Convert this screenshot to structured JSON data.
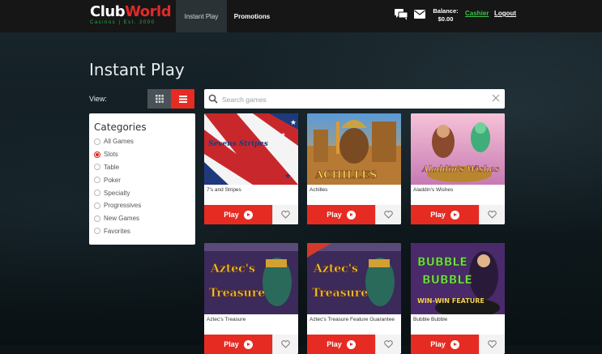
{
  "header": {
    "logo_main_part1": "Club",
    "logo_main_part2": "World",
    "logo_sub": "Casinos | Est. 2000",
    "nav": [
      {
        "label": "Instant Play"
      },
      {
        "label": "Promotions"
      }
    ],
    "balance_label": "Balance:",
    "balance_value": "$0.00",
    "cashier_label": "Cashier",
    "logout_label": "Logout"
  },
  "page": {
    "title": "Instant Play",
    "view_label": "View:"
  },
  "search": {
    "placeholder": "Search games"
  },
  "categories": {
    "title": "Categories",
    "items": [
      {
        "label": "All Games",
        "selected": false
      },
      {
        "label": "Slots",
        "selected": true
      },
      {
        "label": "Table",
        "selected": false
      },
      {
        "label": "Poker",
        "selected": false
      },
      {
        "label": "Specialty",
        "selected": false
      },
      {
        "label": "Progressives",
        "selected": false
      },
      {
        "label": "New Games",
        "selected": false
      },
      {
        "label": "Favorites",
        "selected": false
      }
    ]
  },
  "games": [
    {
      "name": "7's and Stripes",
      "thumb_title": "Sevens Stripes",
      "play_label": "Play"
    },
    {
      "name": "Achilles",
      "thumb_title": "ACHILLES",
      "play_label": "Play"
    },
    {
      "name": "Aladdin's Wishes",
      "thumb_title": "Aladdin's Wishes",
      "play_label": "Play"
    },
    {
      "name": "Aztec's Treasure",
      "thumb_title": "Aztec's Treasure",
      "play_label": "Play"
    },
    {
      "name": "Aztec's Treasure Feature Guarantee",
      "thumb_title": "Aztec's Treasure",
      "play_label": "Play"
    },
    {
      "name": "Bubble Bubble",
      "thumb_title": "Bubble Bubble",
      "thumb_sub": "WIN-WIN FEATURE",
      "play_label": "Play"
    }
  ],
  "colors": {
    "accent_red": "#e52b22",
    "cashier_green": "#39c24a",
    "topbar": "#161616"
  }
}
